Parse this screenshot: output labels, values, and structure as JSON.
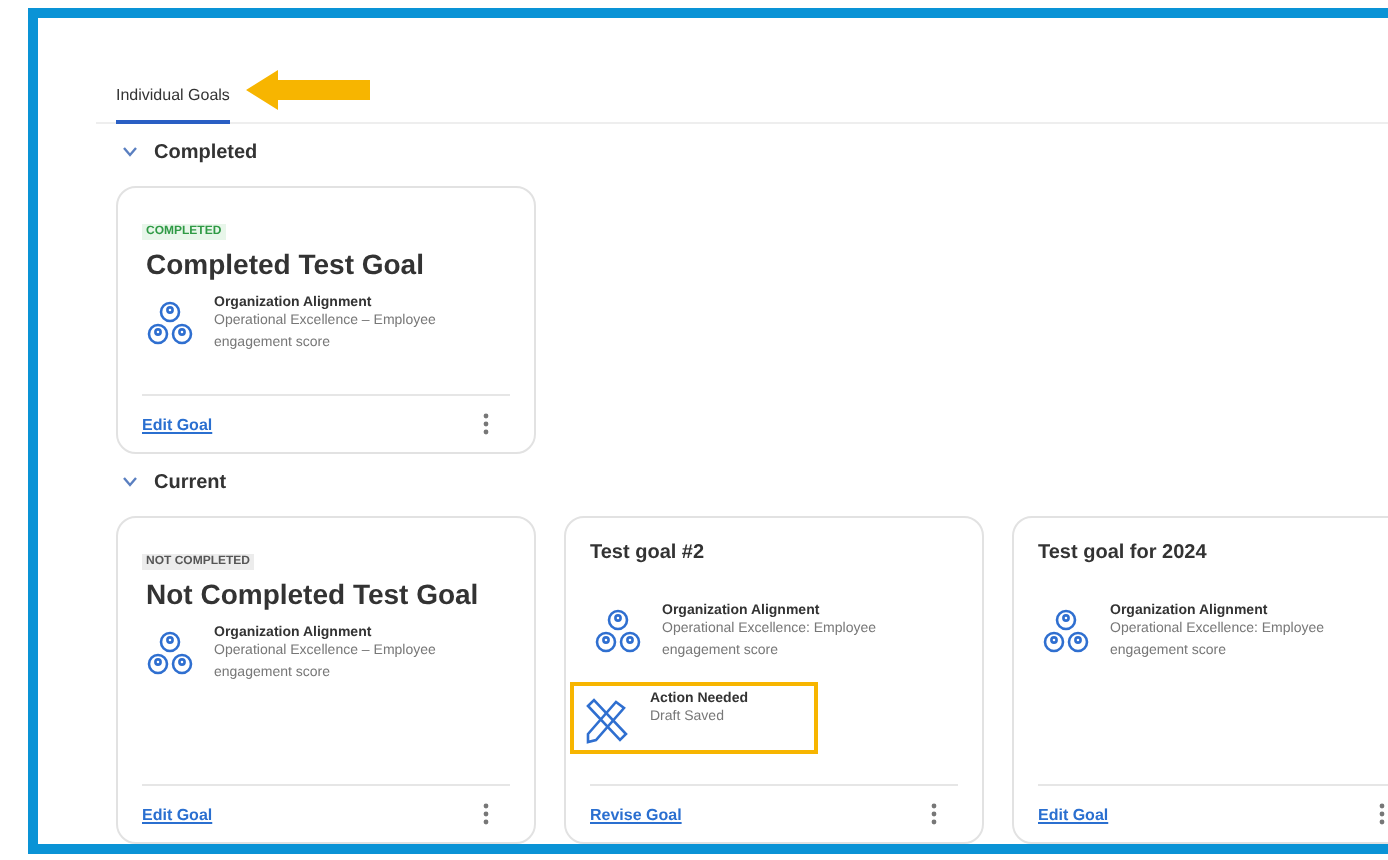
{
  "tabs": [
    {
      "label": "Individual Goals",
      "selected": true
    }
  ],
  "sections": [
    {
      "title": "Completed",
      "expanded": true,
      "cards": [
        {
          "status": {
            "kind": "completed",
            "label": "COMPLETED"
          },
          "title": "Completed Test Goal",
          "alignment": {
            "label": "Organization Alignment",
            "text": "Operational Excellence – Employee engagement score"
          },
          "link": "Edit Goal"
        }
      ]
    },
    {
      "title": "Current",
      "expanded": true,
      "cards": [
        {
          "status": {
            "kind": "not_completed",
            "label": "NOT COMPLETED"
          },
          "title": "Not Completed Test Goal",
          "alignment": {
            "label": "Organization Alignment",
            "text": "Operational Excellence – Employee engagement score"
          },
          "link": "Edit Goal"
        },
        {
          "title": "Test goal #2",
          "alignment": {
            "label": "Organization Alignment",
            "text": "Operational Excellence: Employee engagement score"
          },
          "action": {
            "label": "Action Needed",
            "text": "Draft Saved",
            "highlighted": true
          },
          "link": "Revise Goal"
        },
        {
          "title": "Test goal for 2024",
          "alignment": {
            "label": "Organization Alignment",
            "text": "Operational Excellence: Employee engagement score"
          },
          "link": "Edit Goal"
        }
      ]
    }
  ]
}
